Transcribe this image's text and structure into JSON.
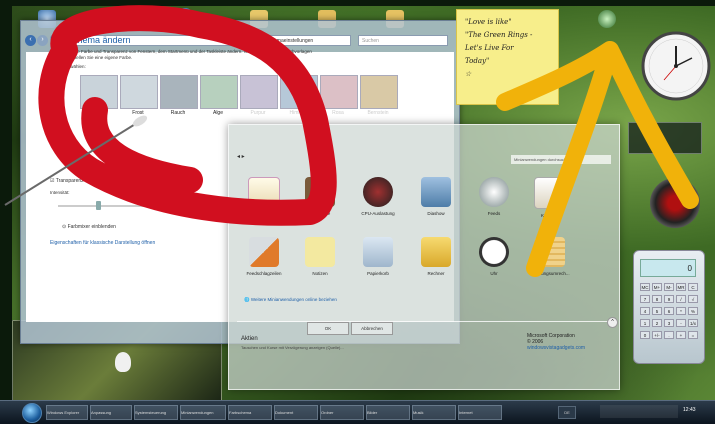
{
  "desktop": {
    "background_color": "#3e6a24"
  },
  "control_panel": {
    "address": "▸ Anpassung ▸ Farbschemaeinstellungen",
    "search_placeholder": "Suchen",
    "title": "Farbschema ändern",
    "description": "Sie können die Farbe und Transparenz von Fenstern, dem Startmenü und der Taskleiste ändern. Wählen Sie aus den Farbvorlagen aus oder erstellen Sie eine eigene Farbe.",
    "select_label": "Farbe auswählen:",
    "swatches": [
      {
        "label": "",
        "color": "#c9d3da"
      },
      {
        "label": "Frost",
        "color": "#cfd8de"
      },
      {
        "label": "Rauch",
        "color": "#a9b4bc"
      },
      {
        "label": "Alge",
        "color": "#b7d0be"
      },
      {
        "label": "Purpur",
        "color": "#c8c2d6"
      },
      {
        "label": "Himmel",
        "color": "#b6c8d8"
      },
      {
        "label": "Rosa",
        "color": "#dcc0c6"
      },
      {
        "label": "Bernstein",
        "color": "#d9c9a6"
      }
    ],
    "transparency_label": "Transparenz aktivieren",
    "intensity_label": "Intensität:",
    "mixer_label": "Farbmixer einblenden",
    "advanced_link": "Eigenschaften für klassische Darstellung öffnen"
  },
  "gallery": {
    "search_placeholder": "Minianwendungen durchsuchen",
    "gadgets": [
      {
        "label": "Aktien",
        "color": "#e8d9b0"
      },
      {
        "label": "Bildpuzzle",
        "color": "#7a5a3a"
      },
      {
        "label": "CPU-Auslastung",
        "color": "#404040"
      },
      {
        "label": "Diashow",
        "color": "#6a8ab0"
      },
      {
        "label": "Feeds",
        "color": "#bfbfbf"
      },
      {
        "label": "Kalender",
        "color": "#e6e0d0"
      },
      {
        "label": "Feedschlagzeilen",
        "color": "#e07a2a"
      },
      {
        "label": "Notizen",
        "color": "#f3e9a0"
      },
      {
        "label": "Papierkorb",
        "color": "#b0c6dc"
      },
      {
        "label": "Rechner",
        "color": "#e8c040"
      },
      {
        "label": "Uhr",
        "color": "#e0e0e0"
      },
      {
        "label": "Währungsumrech...",
        "color": "#f0d28a"
      }
    ],
    "online_link": "Weitere Minianwendungen online beziehen",
    "btn_ok": "OK",
    "btn_cancel": "Abbrechen",
    "details_title": "Aktien",
    "details_desc": "Tauschen und Kurse mit Verzögerung anzeigen (Quelle)...",
    "company": "Microsoft Corporation",
    "company_year": "© 2006",
    "company_link": "windowsvistagadgets.com"
  },
  "note": {
    "lines": [
      "\"Love is like\"",
      "\"The Green Rings -",
      "Let's Live For",
      "Today\"",
      "☆"
    ]
  },
  "calculator": {
    "display": "0",
    "keys": [
      "MC",
      "M+",
      "M-",
      "MR",
      "C",
      "7",
      "8",
      "9",
      "/",
      "√",
      "4",
      "5",
      "6",
      "*",
      "%",
      "1",
      "2",
      "3",
      "-",
      "1/x",
      "0",
      "+/-",
      ".",
      "+",
      "="
    ]
  },
  "taskbar": {
    "buttons": [
      "Windows Explorer",
      "Anpassung",
      "Systemsteuerung",
      "Minianwendungen",
      "Farbschema",
      "Dokument",
      "Ordner",
      "Bilder",
      "Musik",
      "Internet"
    ],
    "clock": "12:43",
    "tray_chip": "DE"
  },
  "annotations": {
    "red_color": "#d10f1f",
    "yellow_color": "#f1b20a"
  }
}
